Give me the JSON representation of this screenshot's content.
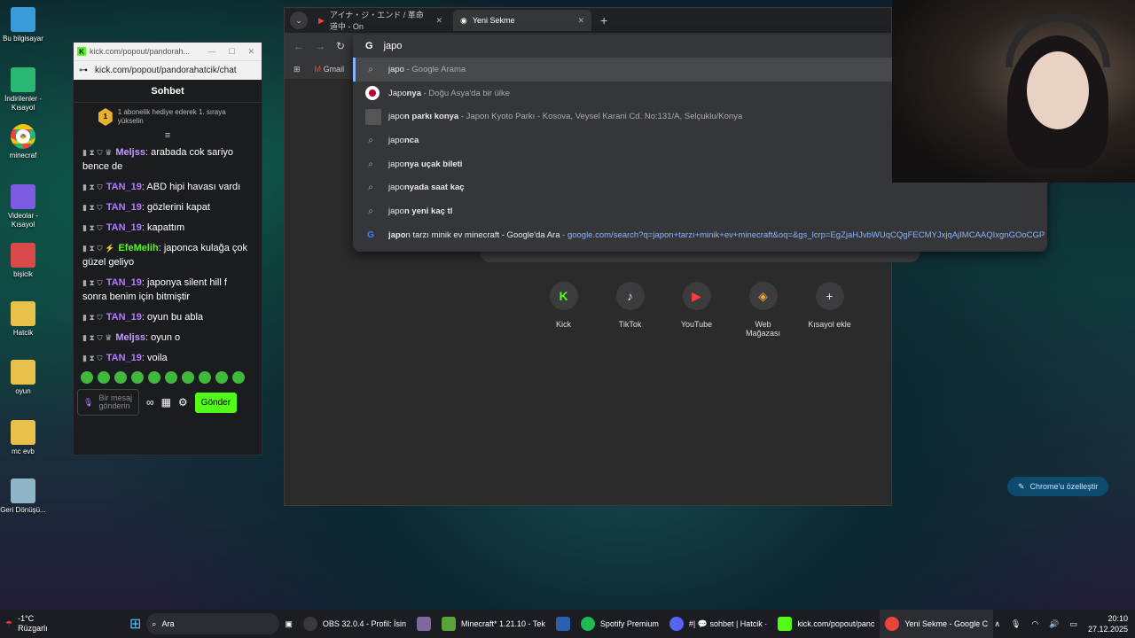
{
  "desktop": {
    "icons": [
      {
        "label": "Bu bilgisayar",
        "color": "#3a9bd9"
      },
      {
        "label": "İndirilenler - Kısayol",
        "color": "#2bb673"
      },
      {
        "label": "minecraf",
        "color": "#e8453c"
      },
      {
        "label": "Videolar - Kısayol",
        "color": "#7b5ce0"
      },
      {
        "label": "bişicik",
        "color": "#d84a4a"
      },
      {
        "label": "Hatcik",
        "color": "#e8c14a"
      },
      {
        "label": "oyun",
        "color": "#e8c14a"
      },
      {
        "label": "mc evb",
        "color": "#e8c14a"
      },
      {
        "label": "Geri Dönüşü...",
        "color": "#8fb5c7"
      }
    ]
  },
  "chat_window": {
    "title": "kick.com/popout/pandorah...",
    "url": "kick.com/popout/pandorahatcik/chat",
    "header": "Sohbet",
    "pinned_number": "1",
    "pinned_text": "1 abonelik hediye ederek 1. sıraya yükselin",
    "messages": [
      {
        "user": "Meljss",
        "text": "arabada cok sariyo bence de",
        "style": "gold"
      },
      {
        "user": "TAN_19",
        "text": "ABD hipi havası vardı",
        "style": "purple"
      },
      {
        "user": "TAN_19",
        "text": "gözlerini kapat",
        "style": "purple"
      },
      {
        "user": "TAN_19",
        "text": "kapattım",
        "style": "purple"
      },
      {
        "user": "EfeMelih",
        "text": "japonca kulağa çok güzel geliyo",
        "style": "green"
      },
      {
        "user": "TAN_19",
        "text": "japonya silent hill f sonra benim için bitmiştir",
        "style": "purple"
      },
      {
        "user": "TAN_19",
        "text": "oyun bu abla",
        "style": "purple"
      },
      {
        "user": "Meljss",
        "text": "oyun o",
        "style": "gold"
      },
      {
        "user": "TAN_19",
        "text": "voila",
        "style": "purple"
      }
    ],
    "input_placeholder": "Bir mesaj gönderin",
    "send_label": "Gönder"
  },
  "browser": {
    "tabs": [
      {
        "title": "アイナ・ジ・エンド / 革命道中 - On",
        "active": false
      },
      {
        "title": "Yeni Sekme",
        "active": true
      }
    ],
    "new_tab": "+",
    "omnibox_value": "japo",
    "bookmark_gmail": "Gmail",
    "suggestions": [
      {
        "icon": "search",
        "bold": "japo",
        "rest": "",
        "desc": " - Google Arama",
        "url": ""
      },
      {
        "icon": "flag-japan",
        "bold": "Japo",
        "rest": "nya",
        "desc": " - Doğu Asya'da bir ülke",
        "url": ""
      },
      {
        "icon": "place",
        "bold": "japo",
        "rest": "n parkı konya",
        "desc": " - Japon Kyoto Parkı - Kosova, Veysel Karani Cd. No:131/A, Selçuklu/Konya",
        "url": ""
      },
      {
        "icon": "search",
        "bold": "japo",
        "rest": "nca",
        "desc": "",
        "url": ""
      },
      {
        "icon": "search",
        "bold": "japo",
        "rest": "nya uçak bileti",
        "desc": "",
        "url": ""
      },
      {
        "icon": "search",
        "bold": "japo",
        "rest": "nyada saat kaç",
        "desc": "",
        "url": ""
      },
      {
        "icon": "search",
        "bold": "japo",
        "rest": "n yeni kaç tl",
        "desc": "",
        "url": ""
      },
      {
        "icon": "google",
        "bold": "japo",
        "rest": "n tarzı minik ev minecraft - Google'da Ara",
        "desc": " - ",
        "url": "google.com/search?q=japon+tarzı+minik+ev+minecraft&oq=&gs_lcrp=EgZjaHJvbWUqCQgFECMYJxjqAjIMCAAQIxgnGOoCGP..."
      }
    ],
    "shortcuts": [
      {
        "label": "Kick",
        "glyph": "K",
        "color": "#53fc18"
      },
      {
        "label": "TikTok",
        "glyph": "♪",
        "color": "#ffffff"
      },
      {
        "label": "YouTube",
        "glyph": "▶",
        "color": "#ff3b3b"
      },
      {
        "label": "Web Mağazası",
        "glyph": "◈",
        "color": "#e8a33a"
      },
      {
        "label": "Kısayol ekle",
        "glyph": "+",
        "color": "#ffffff"
      }
    ],
    "customize_label": "Chrome'u özelleştir"
  },
  "taskbar": {
    "weather_temp": "-1°C",
    "weather_desc": "Rüzgarlı",
    "search_label": "Ara",
    "apps": [
      {
        "label": "OBS 32.0.4 - Profil: İsin",
        "color": "#3a3a3a"
      },
      {
        "label": "",
        "color": "#7a6aa0"
      },
      {
        "label": "Minecraft* 1.21.10 - Tek",
        "color": "#5aa33a"
      },
      {
        "label": "",
        "color": "#2a5fb0"
      },
      {
        "label": "Spotify Premium",
        "color": "#1db954"
      },
      {
        "label": "#| 💬 sohbet | Hatcik ·",
        "color": "#5865f2"
      },
      {
        "label": "kick.com/popout/panc",
        "color": "#53fc18"
      },
      {
        "label": "Yeni Sekme - Google C",
        "color": "#e8453c"
      }
    ],
    "time": "20:10",
    "date": "27.12.2025"
  }
}
